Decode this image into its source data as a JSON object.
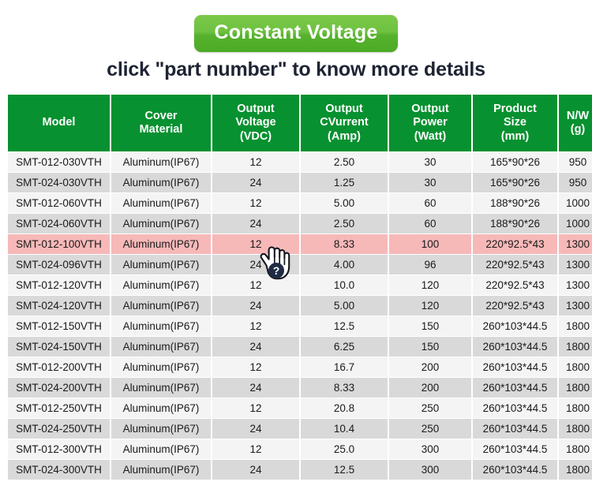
{
  "banner": {
    "label": "Constant Voltage",
    "bg_color_top": "#7cc94a",
    "bg_color_bottom": "#4cab25",
    "text_color": "#ffffff"
  },
  "subtitle": {
    "text": "click \"part number\" to know more details",
    "text_color": "#1e2433"
  },
  "table": {
    "header_bg": "#079130",
    "header_text_color": "#ffffff",
    "row_odd_bg": "#f4f4f4",
    "row_even_bg": "#d9d9d9",
    "highlight_bg": "#f7b8b8",
    "columns": [
      "Model",
      "Cover Material",
      "Output Voltage (VDC)",
      "Output CVurrent (Amp)",
      "Output Power (Watt)",
      "Product Size (mm)",
      "N/W (g)"
    ],
    "columns_lines": [
      [
        "Model"
      ],
      [
        "Cover",
        "Material"
      ],
      [
        "Output",
        "Voltage",
        "(VDC)"
      ],
      [
        "Output",
        "CVurrent",
        "(Amp)"
      ],
      [
        "Output",
        "Power",
        "(Watt)"
      ],
      [
        "Product",
        "Size",
        "(mm)"
      ],
      [
        "N/W",
        "(g)"
      ]
    ],
    "rows": [
      {
        "model": "SMT-012-030VTH",
        "cover": "Aluminum(IP67)",
        "voltage": "12",
        "current": "2.50",
        "power": "30",
        "size": "165*90*26",
        "nw": "950",
        "highlight": false
      },
      {
        "model": "SMT-024-030VTH",
        "cover": "Aluminum(IP67)",
        "voltage": "24",
        "current": "1.25",
        "power": "30",
        "size": "165*90*26",
        "nw": "950",
        "highlight": false
      },
      {
        "model": "SMT-012-060VTH",
        "cover": "Aluminum(IP67)",
        "voltage": "12",
        "current": "5.00",
        "power": "60",
        "size": "188*90*26",
        "nw": "1000",
        "highlight": false
      },
      {
        "model": "SMT-024-060VTH",
        "cover": "Aluminum(IP67)",
        "voltage": "24",
        "current": "2.50",
        "power": "60",
        "size": "188*90*26",
        "nw": "1000",
        "highlight": false
      },
      {
        "model": "SMT-012-100VTH",
        "cover": "Aluminum(IP67)",
        "voltage": "12",
        "current": "8.33",
        "power": "100",
        "size": "220*92.5*43",
        "nw": "1300",
        "highlight": true
      },
      {
        "model": "SMT-024-096VTH",
        "cover": "Aluminum(IP67)",
        "voltage": "24",
        "current": "4.00",
        "power": "96",
        "size": "220*92.5*43",
        "nw": "1300",
        "highlight": false
      },
      {
        "model": "SMT-012-120VTH",
        "cover": "Aluminum(IP67)",
        "voltage": "12",
        "current": "10.0",
        "power": "120",
        "size": "220*92.5*43",
        "nw": "1300",
        "highlight": false
      },
      {
        "model": "SMT-024-120VTH",
        "cover": "Aluminum(IP67)",
        "voltage": "24",
        "current": "5.00",
        "power": "120",
        "size": "220*92.5*43",
        "nw": "1300",
        "highlight": false
      },
      {
        "model": "SMT-012-150VTH",
        "cover": "Aluminum(IP67)",
        "voltage": "12",
        "current": "12.5",
        "power": "150",
        "size": "260*103*44.5",
        "nw": "1800",
        "highlight": false
      },
      {
        "model": "SMT-024-150VTH",
        "cover": "Aluminum(IP67)",
        "voltage": "24",
        "current": "6.25",
        "power": "150",
        "size": "260*103*44.5",
        "nw": "1800",
        "highlight": false
      },
      {
        "model": "SMT-012-200VTH",
        "cover": "Aluminum(IP67)",
        "voltage": "12",
        "current": "16.7",
        "power": "200",
        "size": "260*103*44.5",
        "nw": "1800",
        "highlight": false
      },
      {
        "model": "SMT-024-200VTH",
        "cover": "Aluminum(IP67)",
        "voltage": "24",
        "current": "8.33",
        "power": "200",
        "size": "260*103*44.5",
        "nw": "1800",
        "highlight": false
      },
      {
        "model": "SMT-012-250VTH",
        "cover": "Aluminum(IP67)",
        "voltage": "12",
        "current": "20.8",
        "power": "250",
        "size": "260*103*44.5",
        "nw": "1800",
        "highlight": false
      },
      {
        "model": "SMT-024-250VTH",
        "cover": "Aluminum(IP67)",
        "voltage": "24",
        "current": "10.4",
        "power": "250",
        "size": "260*103*44.5",
        "nw": "1800",
        "highlight": false
      },
      {
        "model": "SMT-012-300VTH",
        "cover": "Aluminum(IP67)",
        "voltage": "12",
        "current": "25.0",
        "power": "300",
        "size": "260*103*44.5",
        "nw": "1800",
        "highlight": false
      },
      {
        "model": "SMT-024-300VTH",
        "cover": "Aluminum(IP67)",
        "voltage": "24",
        "current": "12.5",
        "power": "300",
        "size": "260*103*44.5",
        "nw": "1800",
        "highlight": false
      }
    ]
  },
  "cursor": {
    "icon": "pointing-hand-cursor",
    "badge_icon": "question-mark-badge",
    "badge_label": "?",
    "badge_color": "#1f2a44"
  }
}
